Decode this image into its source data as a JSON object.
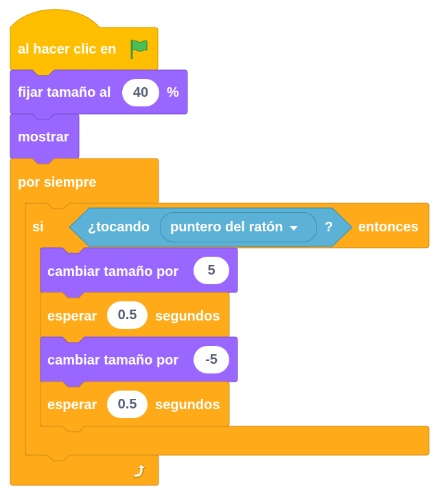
{
  "script": {
    "hat": {
      "label": "al hacer clic en",
      "icon": "green-flag-icon"
    },
    "set_size": {
      "label": "fijar tamaño al",
      "value": "40",
      "suffix": "%"
    },
    "show": {
      "label": "mostrar"
    },
    "forever": {
      "label": "por siempre",
      "icon": "loop-arrow-icon"
    },
    "if_block": {
      "label": "si",
      "then_label": "entonces",
      "condition": {
        "label": "¿tocando",
        "dropdown_value": "puntero del ratón",
        "question": "?"
      }
    },
    "change_size_1": {
      "label": "cambiar tamaño por",
      "value": "5"
    },
    "wait_1": {
      "label": "esperar",
      "value": "0.5",
      "unit": "segundos"
    },
    "change_size_2": {
      "label": "cambiar tamaño por",
      "value": "-5"
    },
    "wait_2": {
      "label": "esperar",
      "value": "0.5",
      "unit": "segundos"
    }
  },
  "colors": {
    "events": "#ffbf00",
    "events_border": "#cc9900",
    "looks": "#9966ff",
    "looks_border": "#774dcb",
    "control": "#ffab19",
    "control_border": "#cf8b17",
    "sensing": "#5cb1d6",
    "sensing_border": "#2e8eb8",
    "text_on_block": "#ffffff",
    "text_in_input": "#575e75"
  }
}
